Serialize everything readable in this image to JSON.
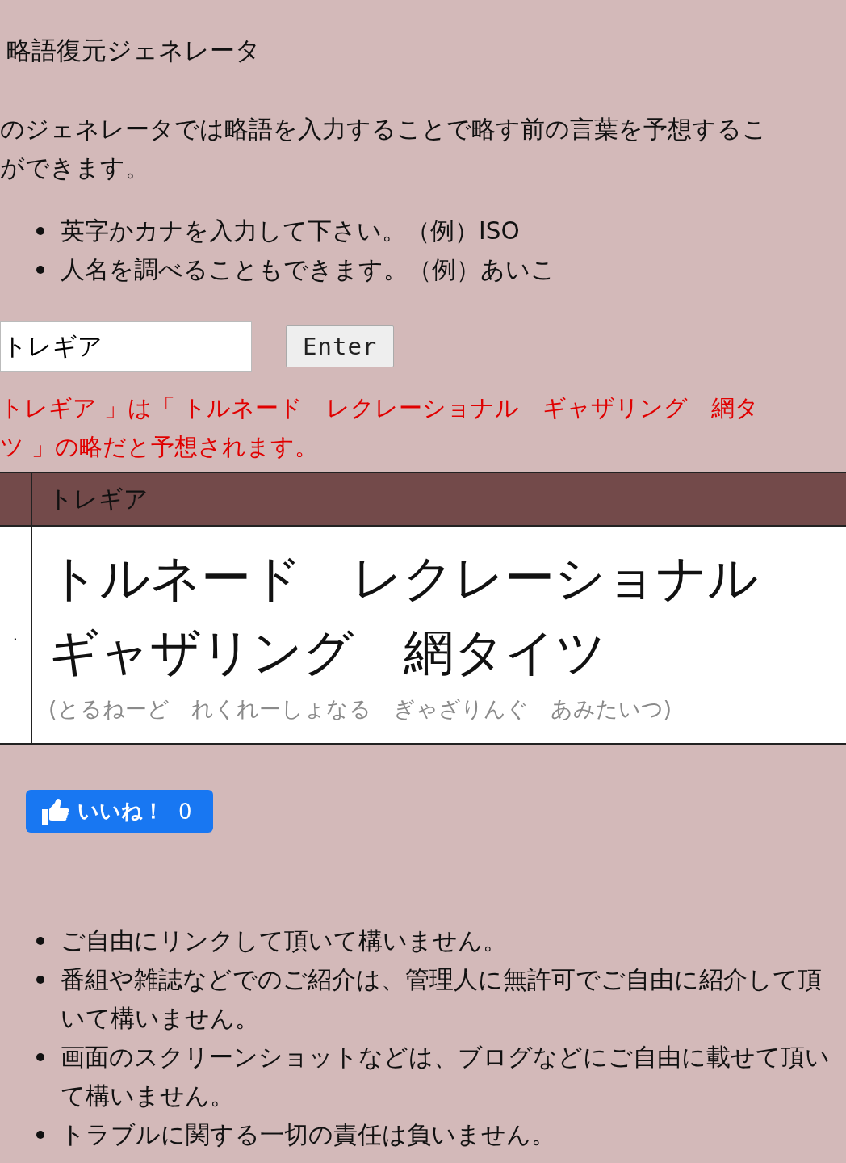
{
  "title": "略語復元ジェネレータ",
  "intro_lines": [
    "のジェネレータでは略語を入力することで略す前の言葉を予想するこ",
    "ができます。"
  ],
  "hints": [
    "英字かカナを入力して下さい。（例）ISO",
    "人名を調べることもできます。（例）あいこ"
  ],
  "search": {
    "value": "トレギア",
    "button": "Enter"
  },
  "result_lines": [
    "トレギア 」は「 トルネード　レクレーショナル　ギャザリング　網タ",
    "ツ 」の略だと予想されます。"
  ],
  "table": {
    "header": "トレギア",
    "row_marker": ".",
    "expansion_lines": [
      "トルネード　レクレーショナル",
      "ギャザリング　網タイツ"
    ],
    "reading": "(とるねーど　れくれーしょなる　ぎゃざりんぐ　あみたいつ)"
  },
  "like_button": {
    "label": "いいね！",
    "count": "0"
  },
  "notes": [
    "ご自由にリンクして頂いて構いません。",
    "番組や雑誌などでのご紹介は、管理人に無許可でご自由に紹介して頂いて構いません。",
    "画面のスクリーンショットなどは、ブログなどにご自由に載せて頂いて構いません。",
    "トラブルに関する一切の責任は負いません。"
  ]
}
